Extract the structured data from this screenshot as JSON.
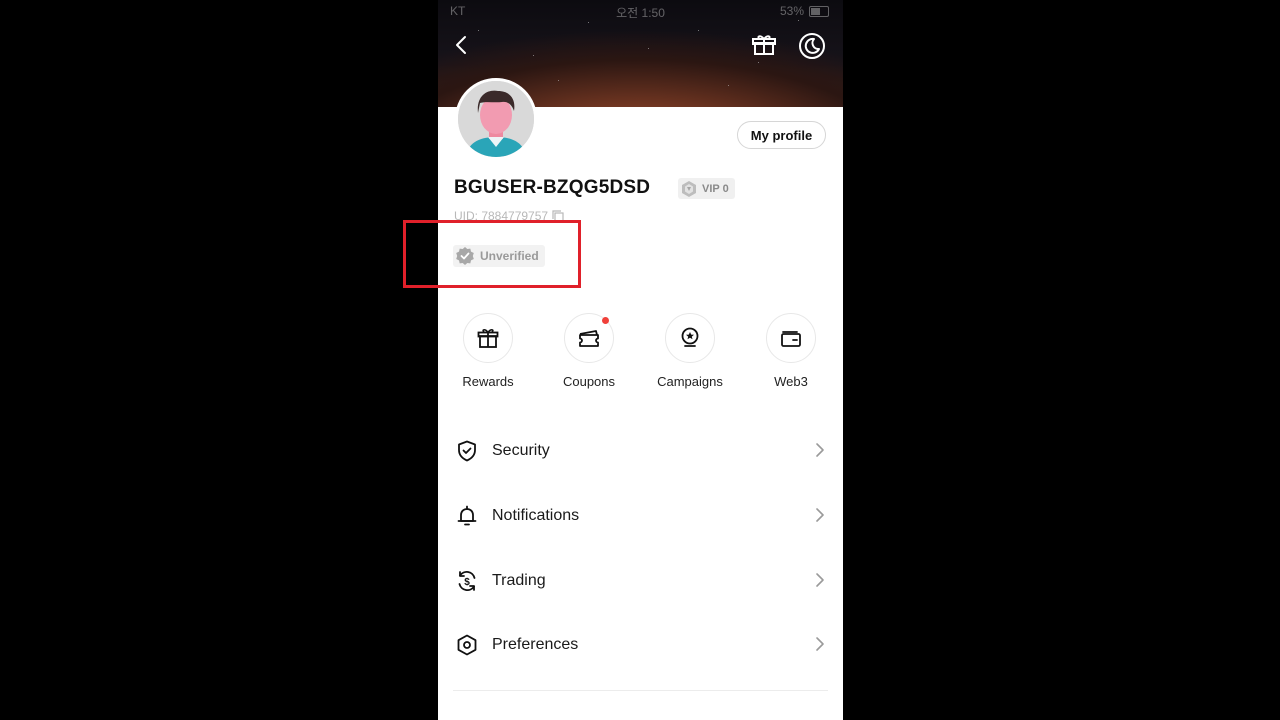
{
  "status_bar": {
    "carrier": "KT",
    "time": "오전 1:50",
    "battery": "53%"
  },
  "profile": {
    "my_profile_label": "My profile",
    "username": "BGUSER-BZQG5DSD",
    "vip_label": "VIP 0",
    "uid_text": "UID: 7884779757",
    "verification_status": "Unverified"
  },
  "shortcuts": [
    {
      "label": "Rewards",
      "icon": "gift-icon"
    },
    {
      "label": "Coupons",
      "icon": "coupon-icon",
      "badge": true
    },
    {
      "label": "Campaigns",
      "icon": "campaign-icon"
    },
    {
      "label": "Web3",
      "icon": "wallet-icon"
    }
  ],
  "menu": [
    {
      "label": "Security",
      "icon": "shield-icon"
    },
    {
      "label": "Notifications",
      "icon": "bell-icon"
    },
    {
      "label": "Trading",
      "icon": "dollar-cycle-icon"
    },
    {
      "label": "Preferences",
      "icon": "hexagon-settings-icon"
    }
  ],
  "colors": {
    "highlight": "#e0202a",
    "badge": "#f0403a",
    "page_bg": "#000000"
  }
}
